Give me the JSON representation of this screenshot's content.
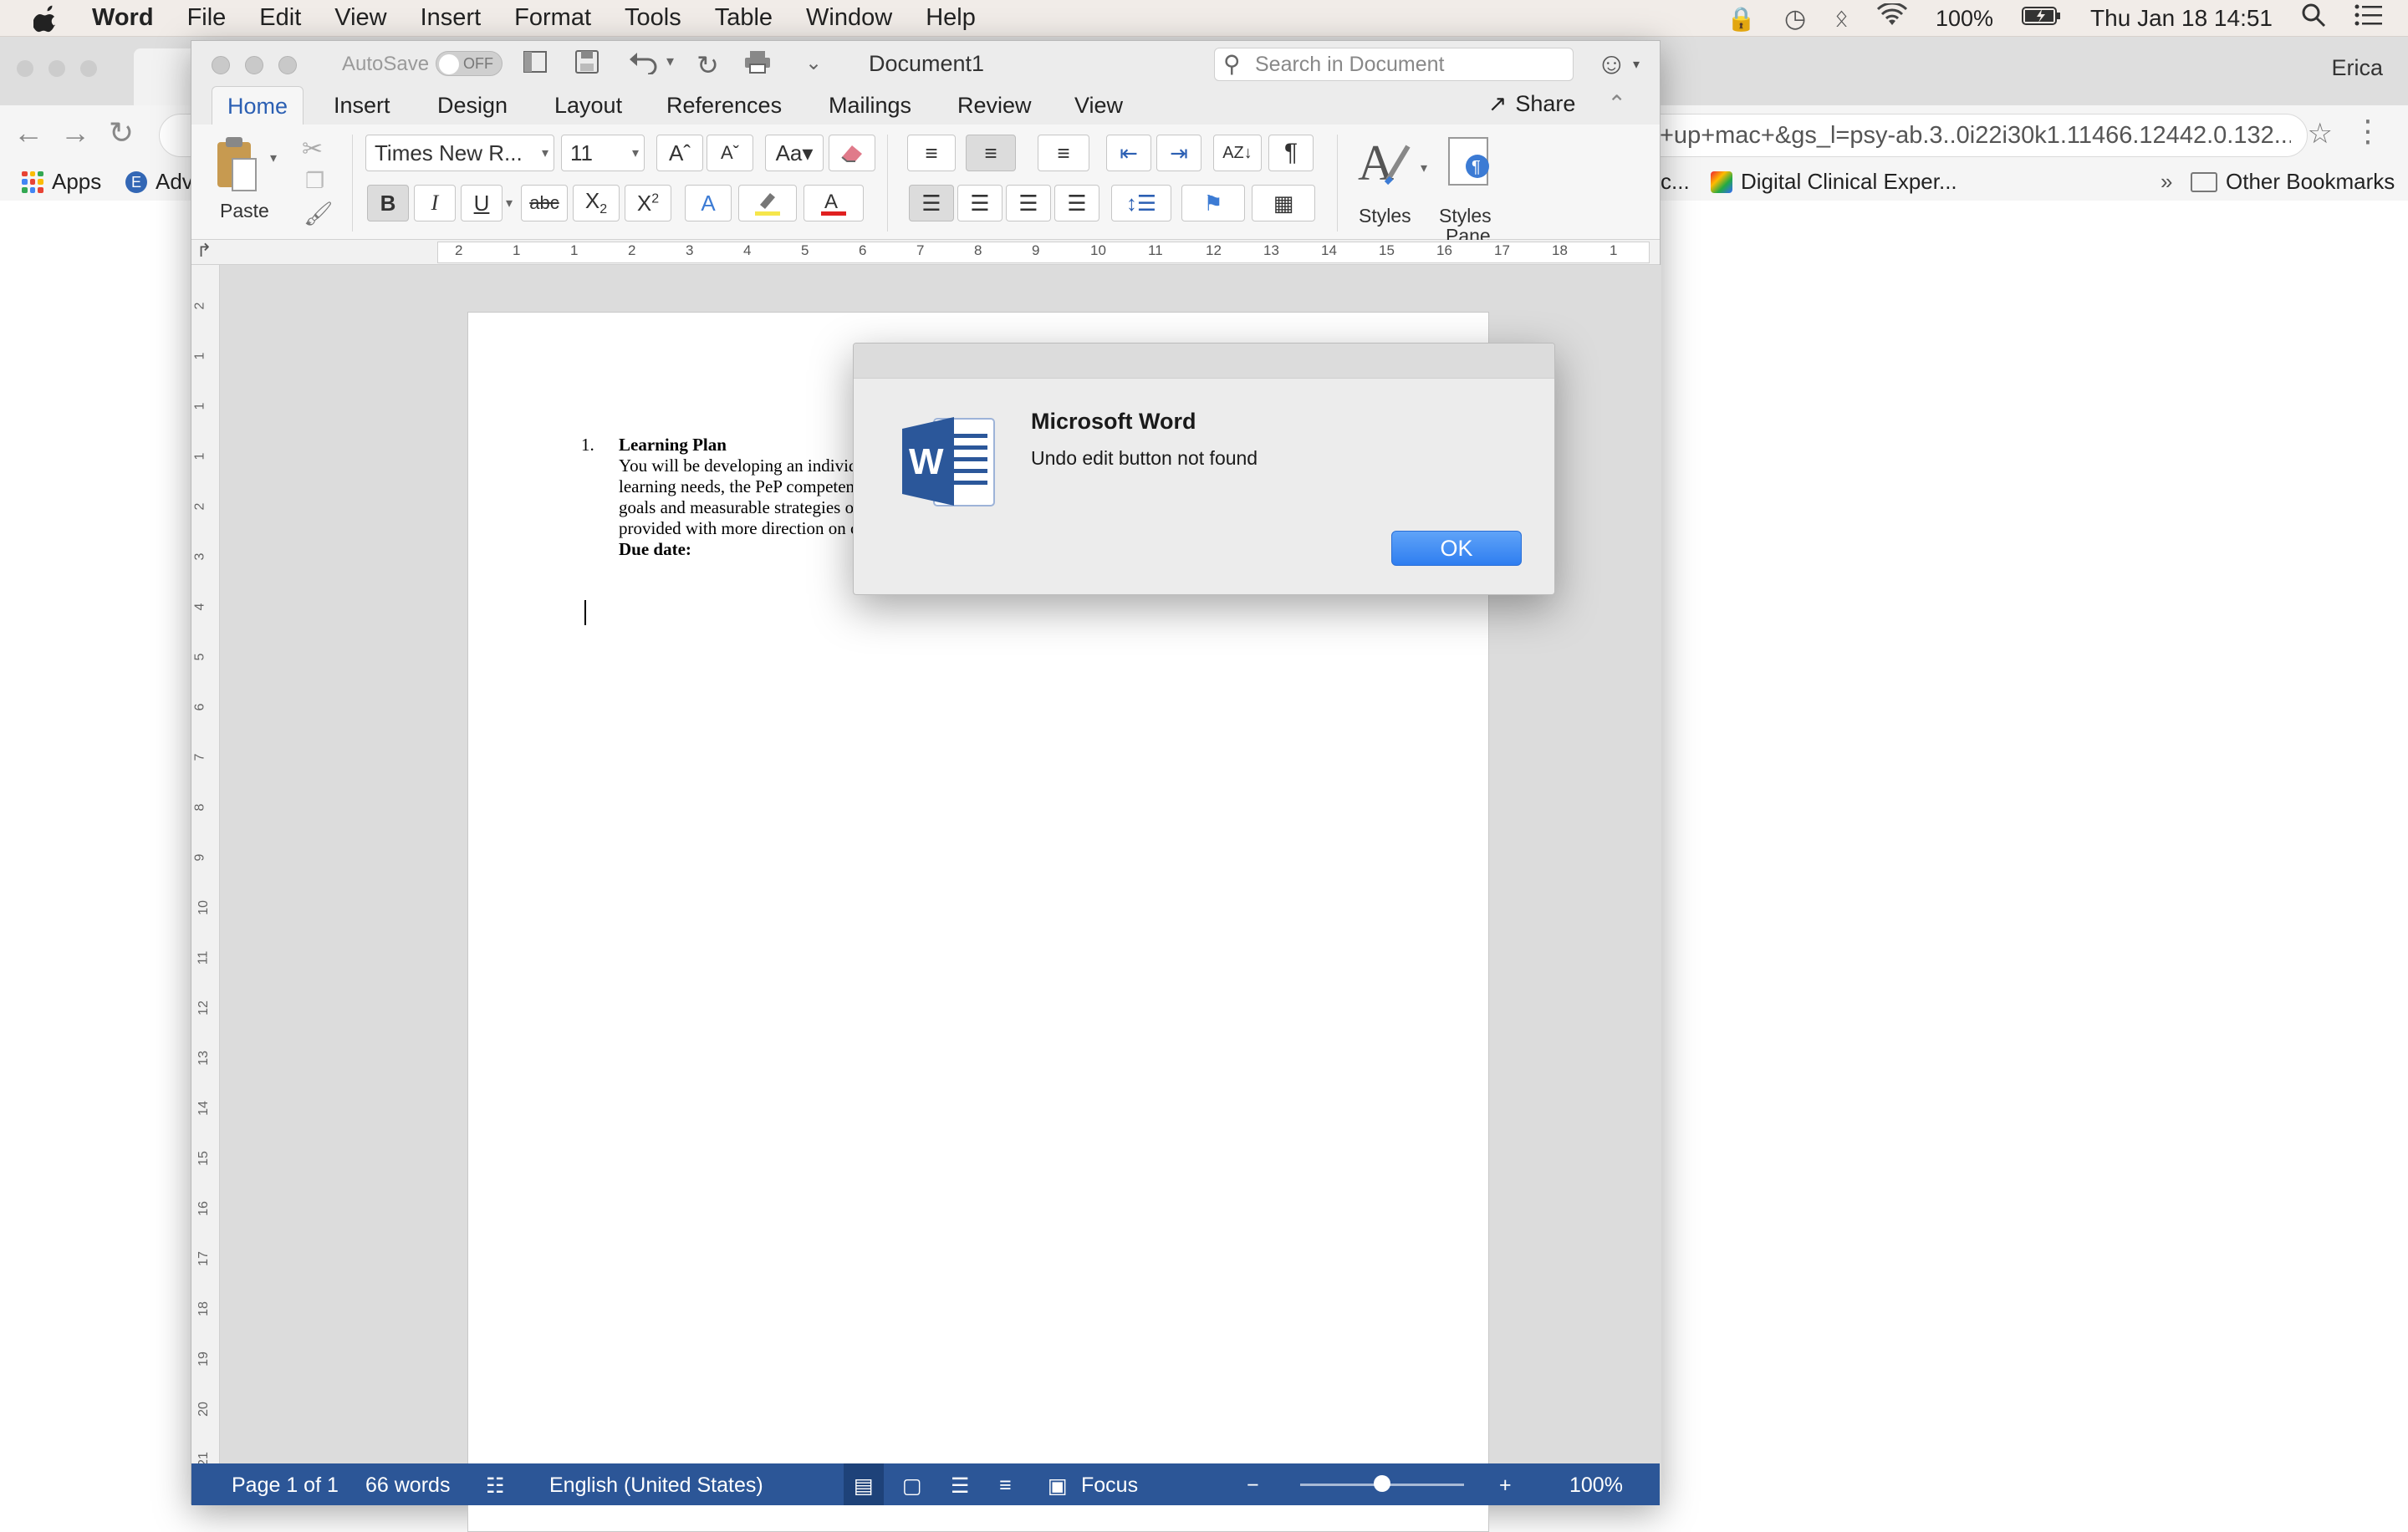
{
  "menubar": {
    "app_name": "Word",
    "items": [
      "File",
      "Edit",
      "View",
      "Insert",
      "Format",
      "Tools",
      "Table",
      "Window",
      "Help"
    ],
    "battery": "100%",
    "datetime": "Thu Jan 18  14:51"
  },
  "chrome": {
    "user": "Erica",
    "url": "+up+mac+&gs_l=psy-ab.3..0i22i30k1.11466.12442.0.132...",
    "bookmarks": {
      "apps": "Apps",
      "adv": "Adv",
      "c": "c...",
      "digital": "Digital Clinical Exper...",
      "chevron": "»",
      "other": "Other Bookmarks"
    }
  },
  "word": {
    "autosave_label": "AutoSave",
    "autosave_state": "OFF",
    "document_title": "Document1",
    "search_placeholder": "Search in Document",
    "tabs": [
      "Home",
      "Insert",
      "Design",
      "Layout",
      "References",
      "Mailings",
      "Review",
      "View"
    ],
    "share_label": "Share",
    "ribbon": {
      "paste_label": "Paste",
      "font_name": "Times New R...",
      "font_size": "11",
      "styles_label": "Styles",
      "styles_pane_label_1": "Styles",
      "styles_pane_label_2": "Pane"
    },
    "ruler_h": [
      "2",
      "1",
      "1",
      "2",
      "3",
      "4",
      "5",
      "6",
      "7",
      "8",
      "9",
      "10",
      "11",
      "12",
      "13",
      "14",
      "15",
      "16",
      "17",
      "18",
      "1"
    ],
    "ruler_v": [
      "2",
      "1",
      "1",
      "1",
      "2",
      "3",
      "4",
      "5",
      "6",
      "7",
      "8",
      "9",
      "10",
      "11",
      "12",
      "13",
      "14",
      "15",
      "16",
      "17",
      "18",
      "19",
      "20",
      "21"
    ],
    "document": {
      "list_number": "1.",
      "heading": "Learning Plan",
      "lines": [
        "You will be developing an individu",
        "learning needs, the PeP competenc",
        "goals and measurable strategies on",
        "provided with more direction on cr"
      ],
      "due_label": "Due date:"
    },
    "status": {
      "page": "Page 1 of 1",
      "words": "66 words",
      "language": "English (United States)",
      "focus": "Focus",
      "zoom_minus": "−",
      "zoom_plus": "+",
      "zoom": "100%"
    },
    "zoom_level": 0.5
  },
  "dialog": {
    "title": "Microsoft Word",
    "message": "Undo edit button not found",
    "ok_label": "OK"
  },
  "colors": {
    "status_bar": "#2c5697",
    "accent": "#2b5fb3",
    "ok_button": "#3a86f2"
  }
}
